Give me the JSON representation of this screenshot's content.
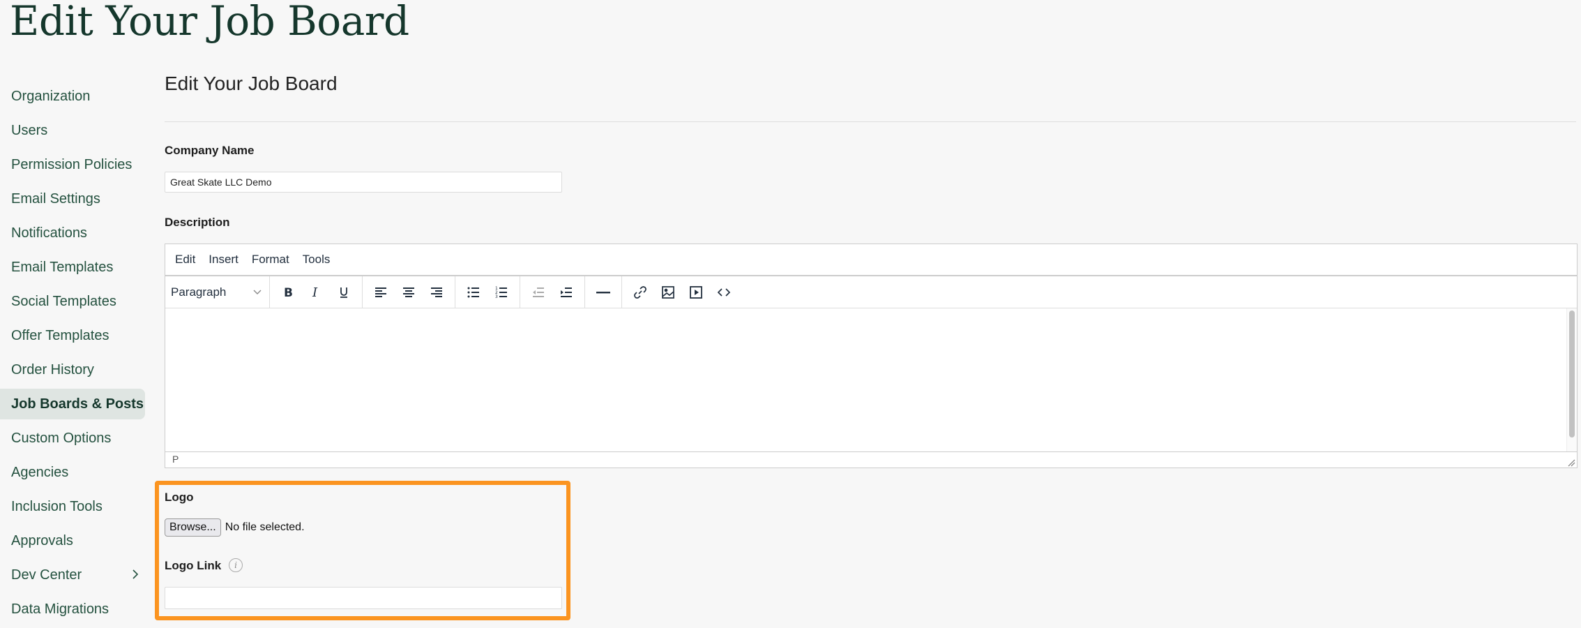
{
  "page": {
    "title": "Edit Your Job Board"
  },
  "sidebar": {
    "items": [
      {
        "label": "Organization"
      },
      {
        "label": "Users"
      },
      {
        "label": "Permission Policies"
      },
      {
        "label": "Email Settings"
      },
      {
        "label": "Notifications"
      },
      {
        "label": "Email Templates"
      },
      {
        "label": "Social Templates"
      },
      {
        "label": "Offer Templates"
      },
      {
        "label": "Order History"
      },
      {
        "label": "Job Boards & Posts",
        "active": true
      },
      {
        "label": "Custom Options"
      },
      {
        "label": "Agencies"
      },
      {
        "label": "Inclusion Tools"
      },
      {
        "label": "Approvals"
      },
      {
        "label": "Dev Center",
        "has_submenu": true,
        "icon": "chevron-right-icon"
      },
      {
        "label": "Data Migrations"
      }
    ]
  },
  "main": {
    "section_title": "Edit Your Job Board",
    "company_name": {
      "label": "Company Name",
      "value": "Great Skate LLC Demo"
    },
    "description": {
      "label": "Description",
      "editor": {
        "menu": [
          "Edit",
          "Insert",
          "Format",
          "Tools"
        ],
        "block_format": "Paragraph",
        "toolbar_icons": [
          "bold-icon",
          "italic-icon",
          "underline-icon",
          "align-left-icon",
          "align-center-icon",
          "align-right-icon",
          "bullet-list-icon",
          "numbered-list-icon",
          "outdent-icon",
          "indent-icon",
          "horizontal-rule-icon",
          "link-icon",
          "image-icon",
          "media-icon",
          "source-code-icon"
        ],
        "content": "",
        "status_path": "P"
      }
    },
    "logo": {
      "label": "Logo",
      "browse_label": "Browse...",
      "file_status": "No file selected."
    },
    "logo_link": {
      "label": "Logo Link",
      "info_icon": "i",
      "value": ""
    },
    "highlight_color": "#fb9420",
    "accent_color": "#15372c"
  }
}
